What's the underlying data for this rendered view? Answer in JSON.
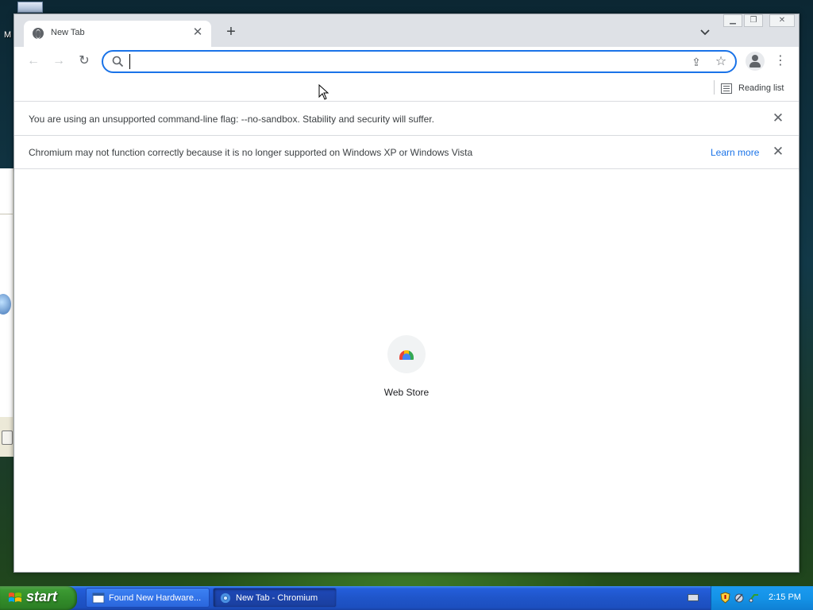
{
  "desktop": {
    "label": "M"
  },
  "browser": {
    "tab": {
      "title": "New Tab",
      "close_label": "✕"
    },
    "new_tab_label": "+",
    "tab_search_label": "⌄",
    "window_controls": {
      "minimize": "▁",
      "maximize": "❐",
      "close": "✕"
    },
    "toolbar": {
      "back_label": "←",
      "forward_label": "→",
      "reload_label": "↻",
      "omnibox": {
        "value": "",
        "placeholder": ""
      },
      "share_label": "⇪",
      "star_label": "☆",
      "menu_label": "⋮"
    },
    "bookmarks_bar": {
      "reading_list_label": "Reading list"
    },
    "infobars": [
      {
        "text": "You are using an unsupported command-line flag: --no-sandbox. Stability and security will suffer.",
        "close_label": "✕"
      },
      {
        "text": "Chromium may not function correctly because it is no longer supported on Windows XP or Windows Vista",
        "link": "Learn more",
        "close_label": "✕"
      }
    ],
    "shortcuts": [
      {
        "label": "Web Store"
      }
    ]
  },
  "taskbar": {
    "start_label": "start",
    "tasks": [
      {
        "label": "Found New Hardware...",
        "active": false
      },
      {
        "label": "New Tab - Chromium",
        "active": true
      }
    ],
    "clock": "2:15 PM"
  },
  "colors": {
    "accent": "#1a73e8",
    "taskbar": "#245edb",
    "start_button": "#3c9a33",
    "tray": "#1493e7"
  }
}
